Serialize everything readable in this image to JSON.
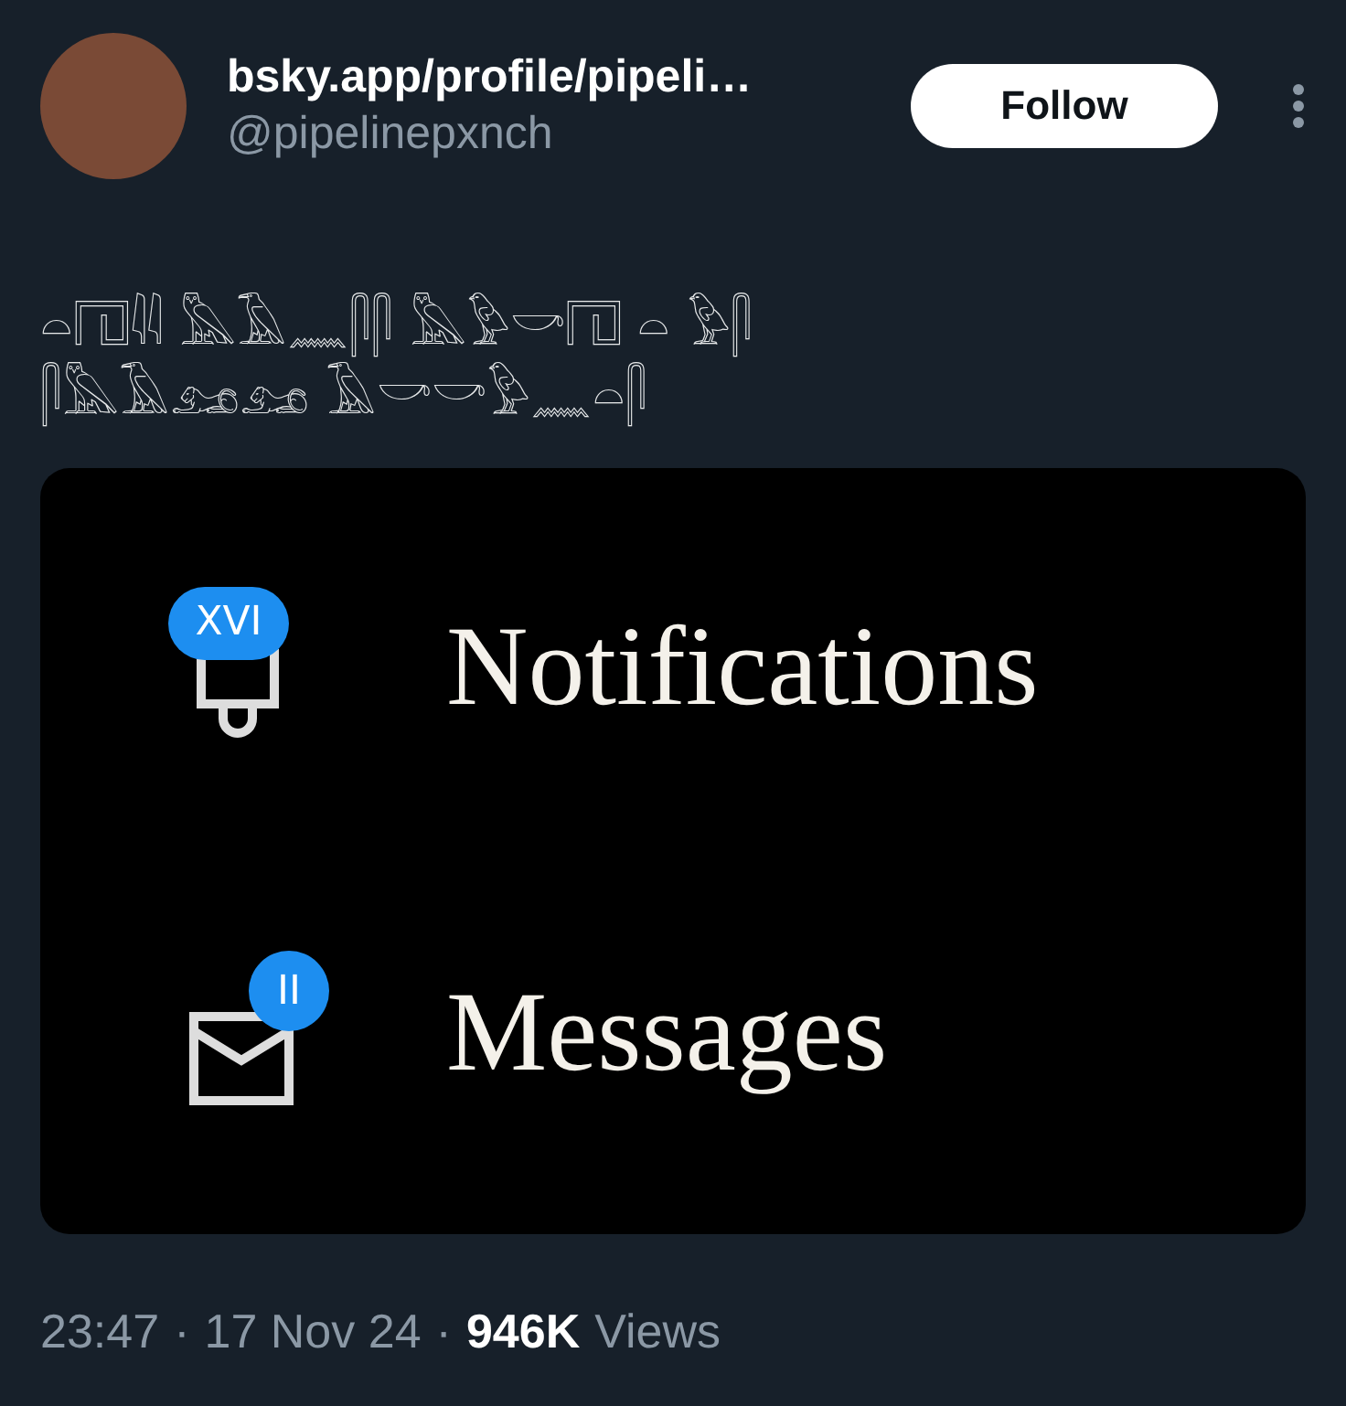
{
  "author": {
    "name": "bsky.app/profile/pipeli…",
    "handle": "@pipelinepxnch"
  },
  "follow_button": {
    "label": "Follow"
  },
  "post_text": [
    "𓏏𓉔𓇌 𓅓𓄿𓈖𓋴𓋴 𓅓𓅱𓎡𓉔 𓏏 𓅱𓋴",
    "𓋴𓅓𓄿𓃭𓃭 𓄿𓎡𓎡𓅱𓈖𓏏𓋴"
  ],
  "embedded_screenshot": {
    "items": [
      {
        "kind": "bell",
        "label": "Notifications",
        "badge": "XVI"
      },
      {
        "kind": "envelope",
        "label": "Messages",
        "badge": "II"
      }
    ]
  },
  "footer": {
    "time": "23:47",
    "separator": "·",
    "date": "17 Nov 24",
    "views_count": "946K",
    "views_label": "Views"
  }
}
